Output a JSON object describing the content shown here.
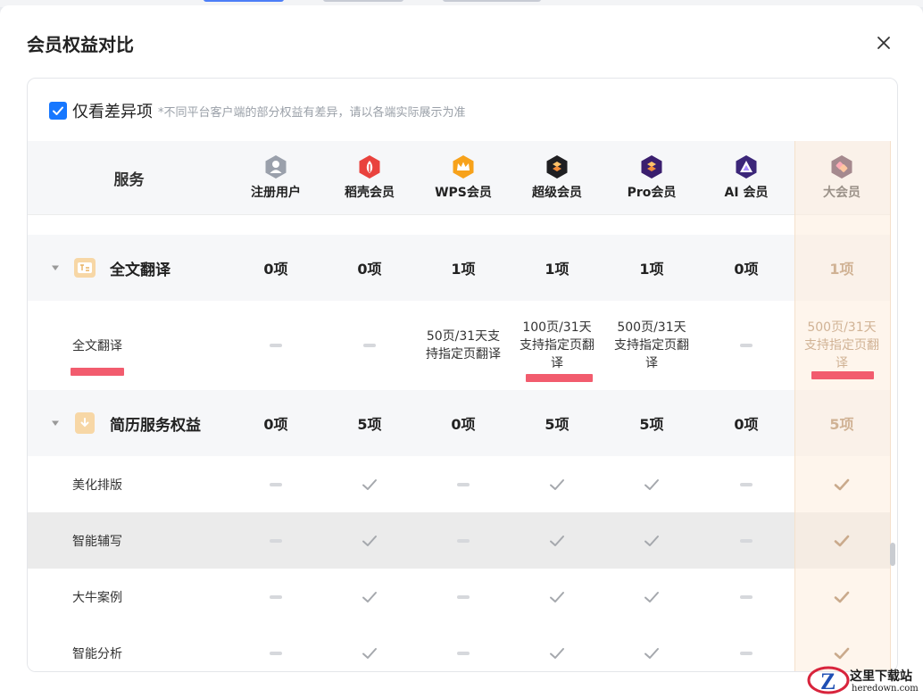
{
  "dialog": {
    "title": "会员权益对比"
  },
  "filter": {
    "checked": true,
    "label": "仅看差异项",
    "note": "*不同平台客户端的部分权益有差异，请以各端实际展示为准"
  },
  "header": {
    "service_label": "服务"
  },
  "plans": [
    {
      "label": "注册用户",
      "icon": "user-icon"
    },
    {
      "label": "稻壳会员",
      "icon": "docer-icon"
    },
    {
      "label": "WPS会员",
      "icon": "crown-icon"
    },
    {
      "label": "超级会员",
      "icon": "super-icon"
    },
    {
      "label": "Pro会员",
      "icon": "pro-icon"
    },
    {
      "label": "AI 会员",
      "icon": "ai-icon"
    },
    {
      "label": "大会员",
      "icon": "big-member-icon"
    }
  ],
  "sections": [
    {
      "name": "全文翻译",
      "icon": "translate-icon",
      "counts": [
        "0项",
        "0项",
        "1项",
        "1项",
        "1项",
        "0项",
        "1项"
      ],
      "features": [
        {
          "name": "全文翻译",
          "kind": "text",
          "values": [
            "",
            "",
            "50页/31天支持指定页翻译",
            "100页/31天支持指定页翻译",
            "500页/31天支持指定页翻译",
            "",
            "500页/31天支持指定页翻译"
          ]
        }
      ]
    },
    {
      "name": "简历服务权益",
      "icon": "resume-icon",
      "counts": [
        "0项",
        "5项",
        "0项",
        "5项",
        "5项",
        "0项",
        "5项"
      ],
      "features": [
        {
          "name": "美化排版",
          "kind": "check",
          "values": [
            false,
            true,
            false,
            true,
            true,
            false,
            true
          ]
        },
        {
          "name": "智能辅写",
          "kind": "check",
          "values": [
            false,
            true,
            false,
            true,
            true,
            false,
            true
          ]
        },
        {
          "name": "大牛案例",
          "kind": "check",
          "values": [
            false,
            true,
            false,
            true,
            true,
            false,
            true
          ]
        },
        {
          "name": "智能分析",
          "kind": "check",
          "values": [
            false,
            true,
            false,
            true,
            true,
            false,
            true
          ]
        }
      ]
    }
  ],
  "colors": {
    "checkbox": "#1677ff",
    "gold_text": "#9a6a3c",
    "check_gray": "#a5a8ad",
    "check_gold": "#8c5a2b",
    "underline": "#f25c6e"
  },
  "watermark": {
    "title": "这里下载站",
    "url": "heredown.com"
  }
}
